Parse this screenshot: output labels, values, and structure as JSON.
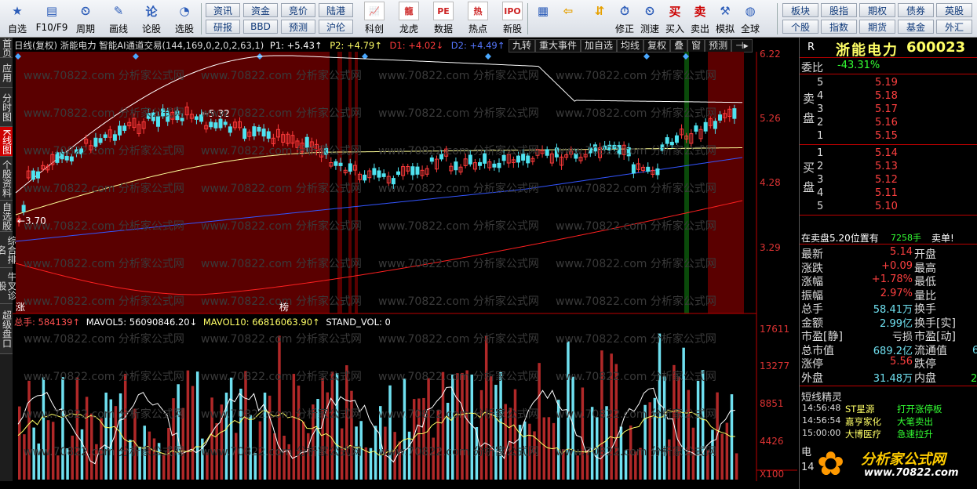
{
  "toolbar": {
    "items": [
      {
        "label": "自选",
        "icon": "star-icon",
        "glyph": "★",
        "color": "#2a5bb8"
      },
      {
        "label": "F10/F9",
        "icon": "f10-icon",
        "glyph": "▤",
        "color": "#2a5bb8"
      },
      {
        "label": "周期",
        "icon": "clock-icon",
        "glyph": "⏲",
        "color": "#2a5bb8"
      },
      {
        "label": "画线",
        "icon": "pen-icon",
        "glyph": "✎",
        "color": "#2a5bb8"
      },
      {
        "label": "论股",
        "icon": "discuss-icon",
        "glyph": "论",
        "color": "#2a5bb8"
      },
      {
        "label": "选股",
        "icon": "select-stock-icon",
        "glyph": "◔",
        "color": "#2a5bb8"
      }
    ],
    "small_buttons": [
      "资讯",
      "资金",
      "竞价",
      "陆港",
      "研报",
      "BBD",
      "预测",
      "沪伦"
    ],
    "items2": [
      {
        "label": "科创",
        "icon": "kechuang-icon",
        "glyph": "📈"
      },
      {
        "label": "龙虎",
        "icon": "longhu-icon",
        "glyph": "龍"
      },
      {
        "label": "数据",
        "icon": "data-icon",
        "glyph": "PE"
      },
      {
        "label": "热点",
        "icon": "hot-icon",
        "glyph": "热"
      },
      {
        "label": "新股",
        "icon": "ipo-icon",
        "glyph": "IPO"
      }
    ],
    "items3": [
      {
        "label": "",
        "icon": "grid-icon",
        "glyph": "▦"
      },
      {
        "label": "",
        "icon": "back-arrow-icon",
        "glyph": "⇦"
      },
      {
        "label": "",
        "icon": "up-down-arrows-icon",
        "glyph": "⇵"
      },
      {
        "label": "修正",
        "icon": "fix-icon",
        "glyph": "⏱"
      },
      {
        "label": "测速",
        "icon": "speedtest-icon",
        "glyph": "⏲"
      },
      {
        "label": "买入",
        "icon": "buy-icon",
        "glyph": "买"
      },
      {
        "label": "卖出",
        "icon": "sell-icon",
        "glyph": "卖"
      },
      {
        "label": "模拟",
        "icon": "simulate-icon",
        "glyph": "⚒"
      },
      {
        "label": "全球",
        "icon": "globe-icon",
        "glyph": "◍"
      }
    ],
    "small_buttons2": [
      "板块",
      "股指",
      "期权",
      "债券",
      "英股",
      "个股",
      "指数",
      "期货",
      "基金",
      "外汇"
    ]
  },
  "sidetabs": [
    "首页",
    "应用",
    "分时图",
    "K线图",
    "个股资料",
    "自选股",
    "综合排名",
    "牛叉诊股",
    "超级盘口"
  ],
  "chart_header": {
    "title": "日线(复权)  浙能电力  智能AI通道交易(144,169,0,2,0,2,63,1)",
    "p1": "P1: +5.43↑",
    "p2": "P2: +4.79↑",
    "d1": "D1: +4.02↓",
    "d2": "D2: +4.49↑",
    "buttons": [
      "九转",
      "重大事件",
      "加自选",
      "均线",
      "复权",
      "叠",
      "窗",
      "预测"
    ]
  },
  "chart_data": {
    "type": "candlestick",
    "title": "浙能电力 日线(复权)",
    "price_axis_ticks": [
      "6.22",
      "5.26",
      "4.28",
      "3.29"
    ],
    "volume_axis_ticks": [
      "17611",
      "13277",
      "8851",
      "4426"
    ],
    "volume_unit": "X100",
    "annotations": {
      "high": "5.32",
      "low": "3.70",
      "marker_left": "涨",
      "marker_mid": "榜"
    },
    "volume_header": {
      "total": "总手: 584139↑",
      "mavol5": "MAVOL5: 56090846.20↓",
      "mavol10": "MAVOL10: 66816063.90↑",
      "stand": "STAND_VOL: 0"
    },
    "series_colors": {
      "up": "#ff3b3b",
      "down": "#4fe3f0",
      "upper_band": "#ffffff",
      "mid_band": "#ffff99",
      "lower_band": "#3355ff",
      "bottom_band": "#ff2020"
    }
  },
  "quote": {
    "name": "浙能电力",
    "code": "600023",
    "r_label": "R",
    "wei_bi_label": "委比",
    "wei_bi": "-43.31%",
    "sell_label": "卖盘",
    "buy_label": "买盘",
    "sell": [
      {
        "lvl": "5",
        "price": "5.19"
      },
      {
        "lvl": "4",
        "price": "5.18"
      },
      {
        "lvl": "3",
        "price": "5.17"
      },
      {
        "lvl": "2",
        "price": "5.16"
      },
      {
        "lvl": "1",
        "price": "5.15"
      }
    ],
    "buy": [
      {
        "lvl": "1",
        "price": "5.14"
      },
      {
        "lvl": "2",
        "price": "5.13"
      },
      {
        "lvl": "3",
        "price": "5.12"
      },
      {
        "lvl": "4",
        "price": "5.11"
      },
      {
        "lvl": "5",
        "price": "5.10"
      }
    ],
    "position_text": "在卖盘5.20位置有",
    "position_vol": "7258手",
    "position_action": "卖单!",
    "stats": [
      {
        "k": "最新",
        "v": "5.14",
        "k2": "开盘"
      },
      {
        "k": "涨跌",
        "v": "+0.09",
        "k2": "最高"
      },
      {
        "k": "涨幅",
        "v": "+1.78%",
        "k2": "最低"
      },
      {
        "k": "振幅",
        "v": "2.97%",
        "k2": "量比"
      },
      {
        "k": "总手",
        "v": "58.41万",
        "k2": "换手"
      },
      {
        "k": "金额",
        "v": "2.99亿",
        "k2": "换手[实]"
      },
      {
        "k": "市盈[静]",
        "v": "亏损",
        "k2": "市盈[动]"
      },
      {
        "k": "总市值",
        "v": "689.2亿",
        "k2": "流通值"
      },
      {
        "k": "涨停",
        "v": "5.56",
        "k2": "跌停"
      },
      {
        "k": "外盘",
        "v": "31.48万",
        "k2": "内盘"
      }
    ],
    "extra_right": [
      "6",
      "2"
    ],
    "elf_title": "短线精灵",
    "elf": [
      {
        "time": "14:56:48",
        "name": "ST星源",
        "event": "打开涨停板"
      },
      {
        "time": "14:56:54",
        "name": "嘉亨家化",
        "event": "大笔卖出"
      },
      {
        "time": "15:00:00",
        "name": "大博医疗",
        "event": "急速拉升"
      }
    ],
    "bottom_left": "电",
    "bottom_left2": "14",
    "logo_text": "分析家公式网",
    "logo_url": "www.70822.com"
  },
  "watermark": "www.70822.com 分析家公式网"
}
